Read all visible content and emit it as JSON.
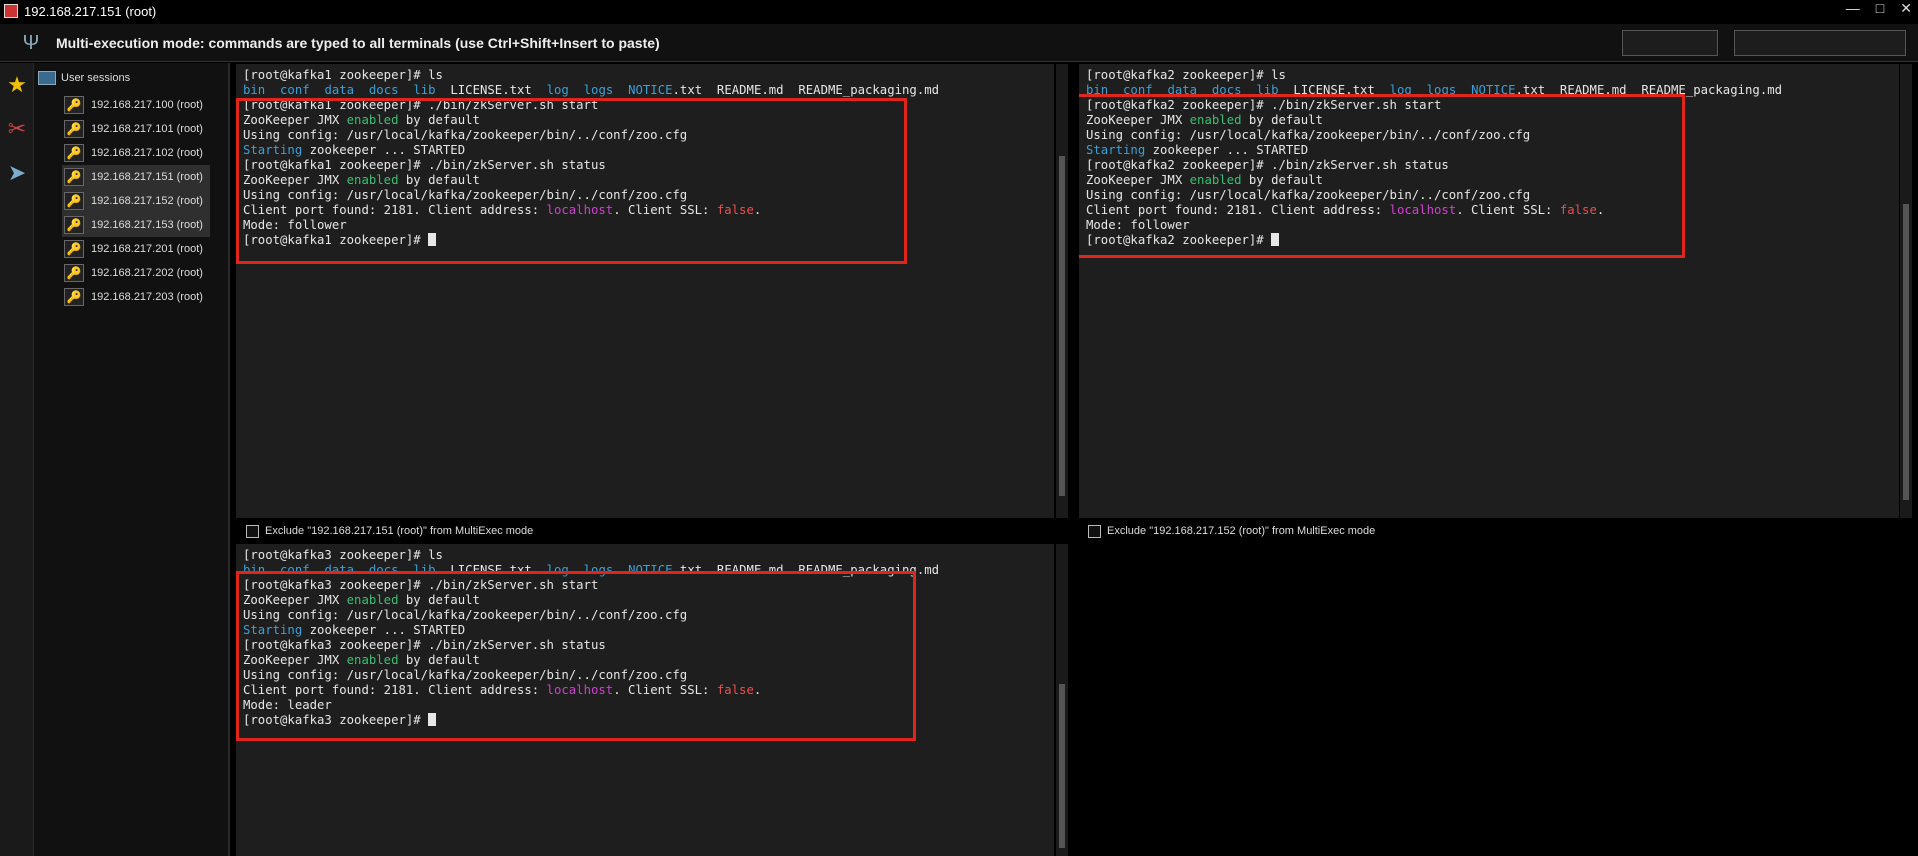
{
  "window": {
    "title": "192.168.217.151 (root)"
  },
  "multiexec": {
    "message": "Multi-execution mode: commands are typed to all terminals (use Ctrl+Shift+Insert to paste)",
    "icon": "fork-icon"
  },
  "sidebar": {
    "header": "User sessions",
    "sessions": [
      {
        "label": "192.168.217.100 (root)",
        "active": false
      },
      {
        "label": "192.168.217.101 (root)",
        "active": false
      },
      {
        "label": "192.168.217.102 (root)",
        "active": false
      },
      {
        "label": "192.168.217.151 (root)",
        "active": true
      },
      {
        "label": "192.168.217.152 (root)",
        "active": true
      },
      {
        "label": "192.168.217.153 (root)",
        "active": true
      },
      {
        "label": "192.168.217.201 (root)",
        "active": false
      },
      {
        "label": "192.168.217.202 (root)",
        "active": false
      },
      {
        "label": "192.168.217.203 (root)",
        "active": false
      }
    ]
  },
  "terminals": {
    "kafka1": {
      "lines": [
        "[root@kafka1 zookeeper]# ls",
        "bin  conf  data  docs  lib  LICENSE.txt  log  logs  NOTICE.txt  README.md  README_packaging.md",
        "[root@kafka1 zookeeper]# ./bin/zkServer.sh start",
        "ZooKeeper JMX enabled by default",
        "Using config: /usr/local/kafka/zookeeper/bin/../conf/zoo.cfg",
        "Starting zookeeper ... STARTED",
        "[root@kafka1 zookeeper]# ./bin/zkServer.sh status",
        "ZooKeeper JMX enabled by default",
        "Using config: /usr/local/kafka/zookeeper/bin/../conf/zoo.cfg",
        "Client port found: 2181. Client address: localhost. Client SSL: false.",
        "Mode: follower",
        "[root@kafka1 zookeeper]# "
      ],
      "exclude_label": "Exclude \"192.168.217.151 (root)\" from MultiExec mode"
    },
    "kafka2": {
      "lines": [
        "[root@kafka2 zookeeper]# ls",
        "bin  conf  data  docs  lib  LICENSE.txt  log  logs  NOTICE.txt  README.md  README_packaging.md",
        "[root@kafka2 zookeeper]# ./bin/zkServer.sh start",
        "ZooKeeper JMX enabled by default",
        "Using config: /usr/local/kafka/zookeeper/bin/../conf/zoo.cfg",
        "Starting zookeeper ... STARTED",
        "[root@kafka2 zookeeper]# ./bin/zkServer.sh status",
        "ZooKeeper JMX enabled by default",
        "Using config: /usr/local/kafka/zookeeper/bin/../conf/zoo.cfg",
        "Client port found: 2181. Client address: localhost. Client SSL: false.",
        "Mode: follower",
        "[root@kafka2 zookeeper]# "
      ],
      "exclude_label": "Exclude \"192.168.217.152 (root)\" from MultiExec mode"
    },
    "kafka3": {
      "lines": [
        "[root@kafka3 zookeeper]# ls",
        "bin  conf  data  docs  lib  LICENSE.txt  log  logs  NOTICE.txt  README.md  README_packaging.md",
        "[root@kafka3 zookeeper]# ./bin/zkServer.sh start",
        "ZooKeeper JMX enabled by default",
        "Using config: /usr/local/kafka/zookeeper/bin/../conf/zoo.cfg",
        "Starting zookeeper ... STARTED",
        "[root@kafka3 zookeeper]# ./bin/zkServer.sh status",
        "ZooKeeper JMX enabled by default",
        "Using config: /usr/local/kafka/zookeeper/bin/../conf/zoo.cfg",
        "Client port found: 2181. Client address: localhost. Client SSL: false.",
        "Mode: leader",
        "[root@kafka3 zookeeper]# "
      ]
    }
  },
  "colors": {
    "highlight": "#e0261a",
    "dir": "#3aa0d8",
    "enabled": "#38c070",
    "localhost": "#d040d0",
    "false": "#e85050"
  }
}
